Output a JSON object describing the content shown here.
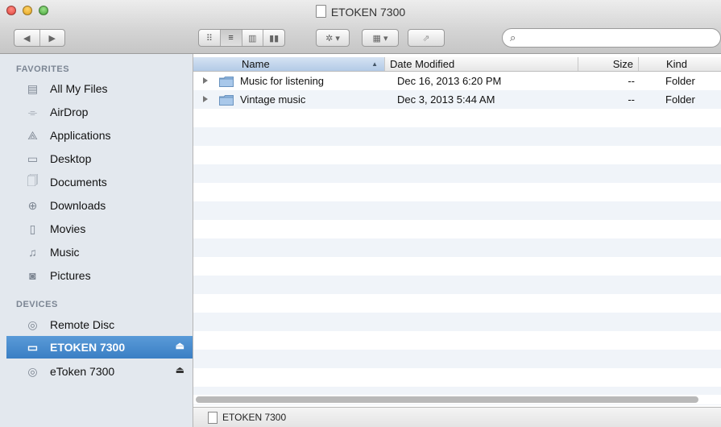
{
  "window": {
    "title": "ETOKEN 7300"
  },
  "toolbar": {
    "back_icon": "back-arrow-icon",
    "forward_icon": "forward-arrow-icon",
    "view_modes": [
      "icon-view-icon",
      "list-view-icon",
      "column-view-icon",
      "coverflow-view-icon"
    ],
    "active_view": "list-view",
    "action_icon": "gear-icon",
    "arrange_icon": "arrange-grid-icon",
    "share_icon": "share-icon",
    "search": {
      "value": "",
      "placeholder": ""
    }
  },
  "sidebar": {
    "favorites_header": "FAVORITES",
    "favorites": [
      {
        "label": "All My Files",
        "icon": "all-files-icon"
      },
      {
        "label": "AirDrop",
        "icon": "airdrop-icon"
      },
      {
        "label": "Applications",
        "icon": "applications-icon"
      },
      {
        "label": "Desktop",
        "icon": "desktop-icon"
      },
      {
        "label": "Documents",
        "icon": "documents-icon"
      },
      {
        "label": "Downloads",
        "icon": "downloads-icon"
      },
      {
        "label": "Movies",
        "icon": "movies-icon"
      },
      {
        "label": "Music",
        "icon": "music-icon"
      },
      {
        "label": "Pictures",
        "icon": "pictures-icon"
      }
    ],
    "devices_header": "DEVICES",
    "devices": [
      {
        "label": "Remote Disc",
        "icon": "disc-icon",
        "eject": false,
        "selected": false
      },
      {
        "label": "ETOKEN 7300",
        "icon": "drive-icon",
        "eject": true,
        "selected": true
      },
      {
        "label": "eToken 7300",
        "icon": "disc-icon",
        "eject": true,
        "selected": false
      }
    ],
    "selection_color": "#3a7fc4"
  },
  "list": {
    "columns": {
      "name": "Name",
      "date": "Date Modified",
      "size": "Size",
      "kind": "Kind"
    },
    "sort_column": "Name",
    "rows": [
      {
        "name": "Music for listening",
        "date": "Dec 16, 2013 6:20 PM",
        "size": "--",
        "kind": "Folder"
      },
      {
        "name": "Vintage music",
        "date": "Dec 3, 2013 5:44 AM",
        "size": "--",
        "kind": "Folder"
      }
    ]
  },
  "pathbar": {
    "label": "ETOKEN 7300"
  }
}
